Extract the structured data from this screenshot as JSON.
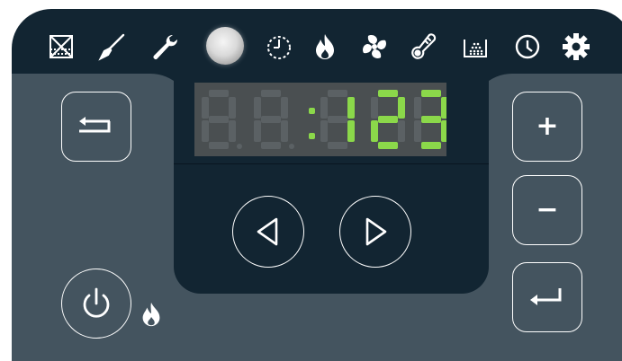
{
  "display": {
    "digits": [
      "8",
      "8",
      "1",
      "2",
      "3"
    ],
    "active": [
      false,
      false,
      true,
      true,
      true
    ],
    "colon_lit": true,
    "lit_color": "#8bd84a",
    "dim_color": "#5b6164"
  },
  "top_icons": [
    {
      "name": "grid-crossed-icon"
    },
    {
      "name": "broom-icon"
    },
    {
      "name": "wrench-icon"
    },
    {
      "name": "indicator-lamp"
    },
    {
      "name": "timer-icon"
    },
    {
      "name": "flame-icon"
    },
    {
      "name": "fan-icon"
    },
    {
      "name": "thermometer-icon"
    },
    {
      "name": "water-bath-icon"
    },
    {
      "name": "clock-icon"
    },
    {
      "name": "gear-icon"
    }
  ],
  "buttons": {
    "back": {
      "icon": "back-arrow-icon"
    },
    "left_arrow": {
      "icon": "triangle-left-icon"
    },
    "right_arrow": {
      "icon": "triangle-right-icon"
    },
    "plus": {
      "label": "+"
    },
    "minus": {
      "label": "−"
    },
    "enter": {
      "icon": "enter-arrow-icon"
    },
    "power": {
      "icon": "power-icon"
    }
  },
  "colors": {
    "panel_dark": "#122532",
    "panel_grey": "#44545f",
    "icon_white": "#ffffff"
  }
}
